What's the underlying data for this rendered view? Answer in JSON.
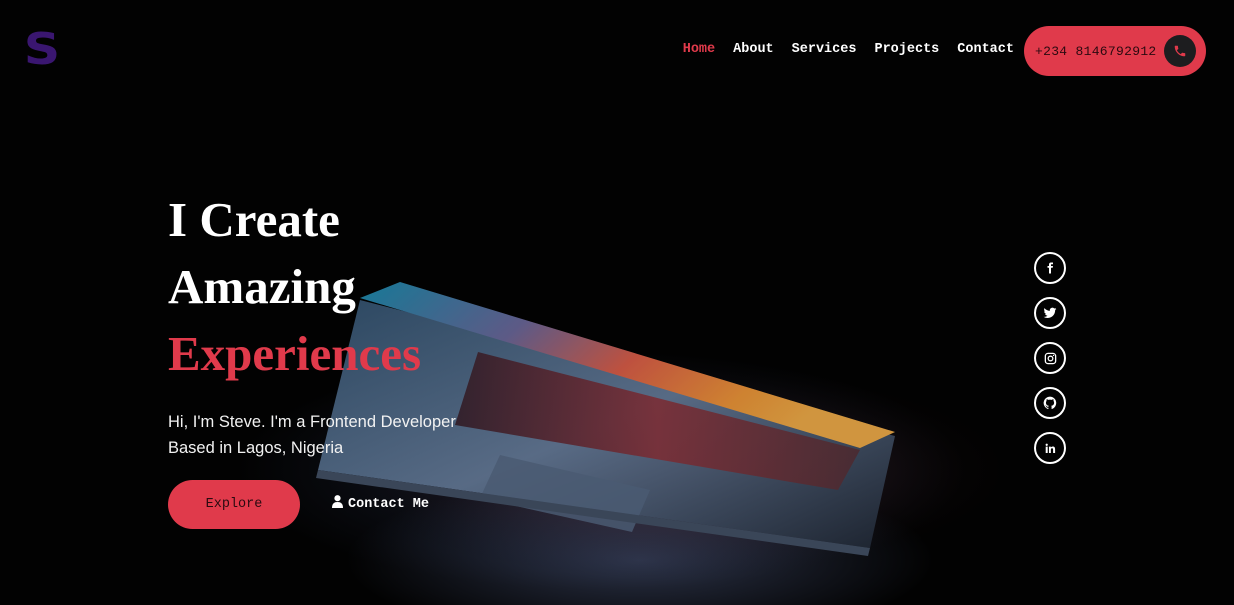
{
  "brand": {
    "logo_text": "S",
    "logo_color": "#3a1670"
  },
  "nav": {
    "items": [
      {
        "label": "Home",
        "active": true
      },
      {
        "label": "About",
        "active": false
      },
      {
        "label": "Services",
        "active": false
      },
      {
        "label": "Projects",
        "active": false
      },
      {
        "label": "Contact",
        "active": false
      }
    ]
  },
  "phone": {
    "number": "+234 8146792912",
    "icon": "phone-icon"
  },
  "hero": {
    "line1": "I Create",
    "line2": "Amazing",
    "line3": "Experiences",
    "intro_line1": "Hi, I'm Steve. I'm a Frontend Developer",
    "intro_line2": "Based in Lagos, Nigeria",
    "explore_label": "Explore",
    "contact_label": "Contact Me",
    "contact_icon": "user-icon"
  },
  "socials": [
    {
      "icon": "facebook-icon"
    },
    {
      "icon": "twitter-icon"
    },
    {
      "icon": "instagram-icon"
    },
    {
      "icon": "github-icon"
    },
    {
      "icon": "linkedin-icon"
    }
  ],
  "colors": {
    "accent": "#e03a4b",
    "background": "#000000",
    "text": "#ffffff"
  }
}
